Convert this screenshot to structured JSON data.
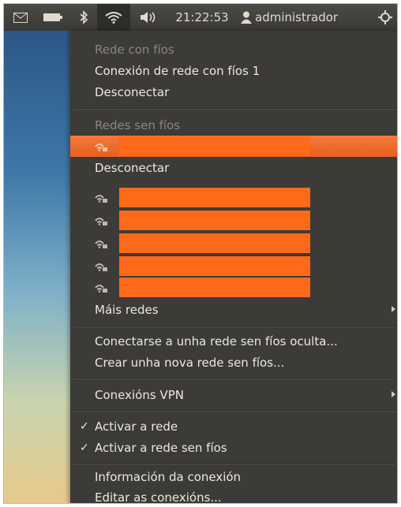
{
  "panel": {
    "time": "21:22:53",
    "user": "administrador",
    "icons": [
      "mail-icon",
      "battery-icon",
      "bluetooth-icon",
      "wifi-icon",
      "volume-icon",
      "user-icon",
      "power-icon"
    ]
  },
  "menu": {
    "wired_header": "Rede con fíos",
    "wired_connection": "Conexión de rede con fíos 1",
    "wired_disconnect": "Desconectar",
    "wireless_header": "Redes sen fíos",
    "wireless_disconnect": "Desconectar",
    "more_networks": "Máis redes",
    "connect_hidden": "Conectarse a unha rede sen fíos oculta...",
    "create_new": "Crear unha nova rede sen fíos...",
    "vpn": "Conexións VPN",
    "enable_networking": "Activar a rede",
    "enable_wireless": "Activar a rede sen fíos",
    "connection_info": "Información da conexión",
    "edit_connections": "Editar as conexións...",
    "checkmark": "✓"
  },
  "colors": {
    "menu_bg": "#3c3b37",
    "highlight": "#e85f1f",
    "redaction": "#ff6a1a",
    "panel_bg": "#3b3a36"
  }
}
